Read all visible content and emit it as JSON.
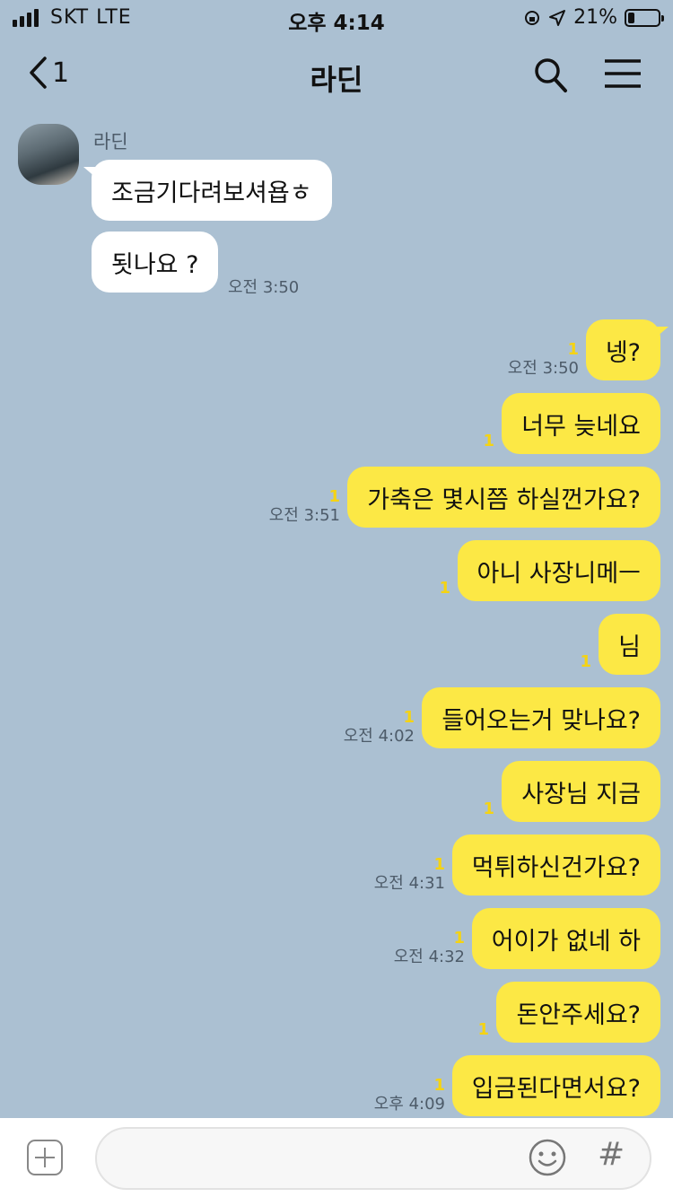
{
  "status_bar": {
    "carrier": "SKT  LTE",
    "time": "오후 4:14",
    "battery": "21%",
    "battery_level": 0.21
  },
  "header": {
    "back_count": "1",
    "title": "라딘"
  },
  "chat": {
    "sender_name": "라딘",
    "incoming": [
      {
        "text": "조금기다려보셔욥ㅎ"
      },
      {
        "text": "됫나요 ?",
        "time": "오전 3:50"
      }
    ],
    "outgoing": [
      {
        "text": "넹?",
        "unread": "1",
        "time": "오전 3:50"
      },
      {
        "text": "너무 늦네요",
        "unread": "1",
        "time": ""
      },
      {
        "text": "가축은 몇시쯤 하실껀가요?",
        "unread": "1",
        "time": "오전 3:51"
      },
      {
        "text": "아니 사장니메ㅡ",
        "unread": "1",
        "time": ""
      },
      {
        "text": "님",
        "unread": "1",
        "time": ""
      },
      {
        "text": "들어오는거 맞나요?",
        "unread": "1",
        "time": "오전 4:02"
      },
      {
        "text": "사장님 지금",
        "unread": "1",
        "time": ""
      },
      {
        "text": "먹튀하신건가요?",
        "unread": "1",
        "time": "오전 4:31"
      },
      {
        "text": "어이가 없네 하",
        "unread": "1",
        "time": "오전 4:32"
      },
      {
        "text": "돈안주세요?",
        "unread": "1",
        "time": ""
      },
      {
        "text": "입금된다면서요?",
        "unread": "1",
        "time": "오후 4:09"
      }
    ]
  },
  "input_bar": {
    "placeholder": "",
    "hash_label": "#"
  },
  "icons": [
    "signal-icon",
    "battery-icon",
    "chevron-left-icon",
    "search-icon",
    "menu-icon",
    "plus-icon",
    "emoji-icon",
    "hash-icon"
  ],
  "colors": {
    "background": "#abc0d2",
    "outgoing_bubble": "#fce845",
    "incoming_bubble": "#ffffff",
    "unread": "#f5d312"
  }
}
